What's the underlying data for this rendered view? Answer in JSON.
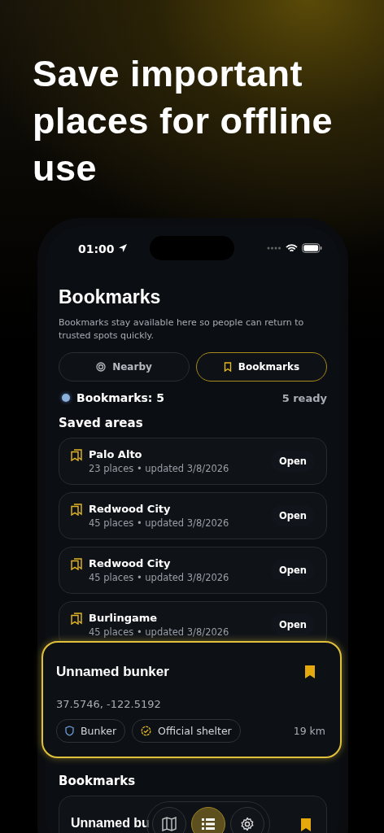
{
  "headline": "Save important places for offline use",
  "status_bar": {
    "time": "01:00"
  },
  "screen": {
    "title": "Bookmarks",
    "description": "Bookmarks stay available here so people can return to trusted spots quickly."
  },
  "tabs": [
    {
      "label": "Nearby",
      "kind": "nearby",
      "selected": false
    },
    {
      "label": "Bookmarks",
      "kind": "bookmarks",
      "selected": true
    }
  ],
  "summary": {
    "label": "Bookmarks: 5",
    "ready": "5 ready"
  },
  "saved_areas": {
    "title": "Saved areas",
    "items": [
      {
        "name": "Palo Alto",
        "meta": "23 places • updated 3/8/2026",
        "action": "Open"
      },
      {
        "name": "Redwood City",
        "meta": "45 places • updated 3/8/2026",
        "action": "Open"
      },
      {
        "name": "Redwood City",
        "meta": "45 places • updated 3/8/2026",
        "action": "Open"
      },
      {
        "name": "Burlingame",
        "meta": "45 places • updated 3/8/2026",
        "action": "Open"
      }
    ]
  },
  "featured": {
    "title": "Unnamed bunker",
    "coords": "37.5746, -122.5192",
    "bookmarked": true,
    "distance": "19 km",
    "tags": [
      {
        "label": "Bunker",
        "kind": "shield"
      },
      {
        "label": "Official shelter",
        "kind": "verified"
      }
    ]
  },
  "bookmarks": {
    "title": "Bookmarks",
    "items": [
      {
        "title": "Unnamed bu",
        "bookmarked": true
      }
    ]
  },
  "nav": [
    {
      "kind": "map",
      "selected": false
    },
    {
      "kind": "list",
      "selected": true
    },
    {
      "kind": "settings",
      "selected": false
    }
  ]
}
